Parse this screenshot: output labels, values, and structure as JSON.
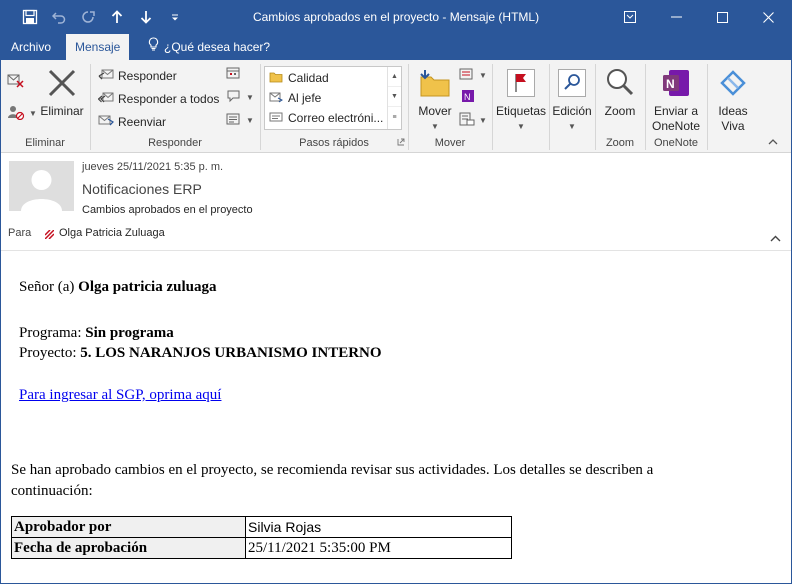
{
  "window": {
    "title": "Cambios aprobados en el proyecto - Mensaje (HTML)"
  },
  "tabs": [
    {
      "label": "Archivo"
    },
    {
      "label": "Mensaje"
    }
  ],
  "tell_me": "¿Qué desea hacer?",
  "ribbon": {
    "eliminar_group": {
      "label": "Eliminar",
      "delete_button": "Eliminar"
    },
    "responder_group": {
      "label": "Responder",
      "reply": "Responder",
      "reply_all": "Responder a todos",
      "forward": "Reenviar"
    },
    "quick_steps": {
      "label": "Pasos rápidos",
      "items": [
        "Calidad",
        "Al jefe",
        "Correo electróni..."
      ]
    },
    "mover_group": {
      "label": "Mover",
      "move_button": "Mover"
    },
    "etiquetas": "Etiquetas",
    "edicion": "Edición",
    "zoom_group": {
      "label": "Zoom",
      "zoom_button": "Zoom"
    },
    "onenote_group": {
      "label": "OneNote",
      "send_line1": "Enviar a",
      "send_line2": "OneNote"
    },
    "ideas": {
      "line1": "Ideas",
      "line2": "Viva"
    }
  },
  "header": {
    "date": "jueves 25/11/2021 5:35 p. m.",
    "sender": "Notificaciones ERP",
    "subject": "Cambios aprobados en el proyecto",
    "to_label": "Para",
    "to_name": "Olga Patricia Zuluaga"
  },
  "body": {
    "greeting_prefix": "Señor (a) ",
    "greeting_name": "Olga patricia zuluaga",
    "program_label": "Programa: ",
    "program_value": "Sin programa",
    "project_label": "Proyecto: ",
    "project_value": "5. LOS NARANJOS URBANISMO INTERNO",
    "link_text": "Para ingresar al SGP, oprima aquí",
    "notice": "Se han aprobado cambios en el proyecto, se recomienda revisar sus actividades. Los detalles se describen a continuación:",
    "details": [
      {
        "key": "Aprobador por",
        "value": "Silvia Rojas"
      },
      {
        "key": "Fecha de aprobación",
        "value": "25/11/2021 5:35:00 PM"
      }
    ]
  },
  "colors": {
    "brand": "#2b579a",
    "ribbon_bg": "#f3f3f3",
    "link": "#0000ee",
    "onenote": "#7719aa",
    "flag_red": "#c50f1f"
  }
}
